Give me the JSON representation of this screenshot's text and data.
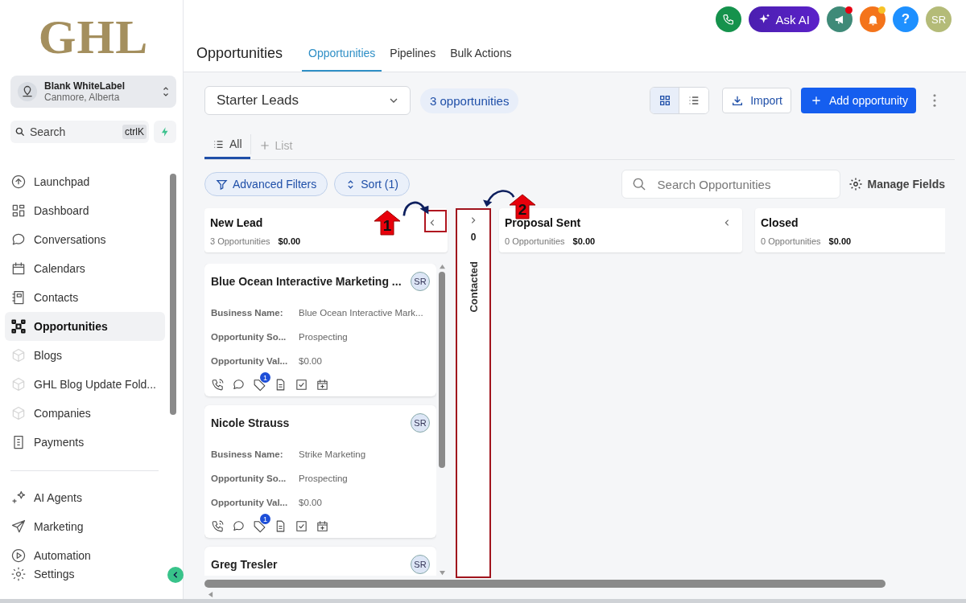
{
  "sidebar": {
    "logo": "GHL",
    "account": {
      "name": "Blank WhiteLabel",
      "location": "Canmore, Alberta"
    },
    "search": {
      "placeholder": "Search",
      "shortcut": "ctrlK"
    },
    "items": [
      {
        "label": "Launchpad",
        "selected": false
      },
      {
        "label": "Dashboard",
        "selected": false
      },
      {
        "label": "Conversations",
        "selected": false
      },
      {
        "label": "Calendars",
        "selected": false
      },
      {
        "label": "Contacts",
        "selected": false
      },
      {
        "label": "Opportunities",
        "selected": true
      },
      {
        "label": "Blogs",
        "selected": false
      },
      {
        "label": "GHL Blog Update Fold...",
        "selected": false
      },
      {
        "label": "Companies",
        "selected": false
      },
      {
        "label": "Payments",
        "selected": false
      }
    ],
    "bottom_items": [
      {
        "label": "AI Agents",
        "selected": false
      },
      {
        "label": "Marketing",
        "selected": false
      },
      {
        "label": "Automation",
        "selected": false
      },
      {
        "label": "Settings",
        "selected": false
      }
    ]
  },
  "topbar": {
    "ask_ai": "Ask AI",
    "help": "?",
    "avatar": "SR"
  },
  "header": {
    "title": "Opportunities",
    "tabs": [
      {
        "label": "Opportunities",
        "selected": true
      },
      {
        "label": "Pipelines",
        "selected": false
      },
      {
        "label": "Bulk Actions",
        "selected": false
      }
    ]
  },
  "toolbar": {
    "pipeline": "Starter Leads",
    "count": "3 opportunities",
    "view_modes": [
      {
        "kind": "grid",
        "selected": true
      },
      {
        "kind": "list",
        "selected": false
      }
    ],
    "import": "Import",
    "add": "Add opportunity"
  },
  "view_tabs": [
    {
      "label": "All",
      "selected": true
    }
  ],
  "add_list": "List",
  "filters": {
    "advanced": "Advanced Filters",
    "sort": "Sort (1)",
    "search_placeholder": "Search Opportunities",
    "manage_fields": "Manage Fields"
  },
  "columns": [
    {
      "name": "New Lead",
      "count": "3 Opportunities",
      "value": "$0.00",
      "collapsed": false,
      "callout": "1",
      "cards": [
        {
          "title": "Blue Ocean Interactive Marketing ...",
          "avatar": "SR",
          "fields": [
            {
              "label": "Business Name:",
              "value": "Blue Ocean Interactive Mark..."
            },
            {
              "label": "Opportunity So...",
              "value": "Prospecting"
            },
            {
              "label": "Opportunity Val...",
              "value": "$0.00"
            }
          ],
          "badge": "1"
        },
        {
          "title": "Nicole Strauss",
          "avatar": "SR",
          "fields": [
            {
              "label": "Business Name:",
              "value": "Strike Marketing"
            },
            {
              "label": "Opportunity So...",
              "value": "Prospecting"
            },
            {
              "label": "Opportunity Val...",
              "value": "$0.00"
            }
          ],
          "badge": "1"
        },
        {
          "title": "Greg Tresler",
          "avatar": "SR"
        }
      ]
    },
    {
      "name": "Contacted",
      "count": "0",
      "collapsed": true,
      "callout": "2"
    },
    {
      "name": "Proposal Sent",
      "count": "0 Opportunities",
      "value": "$0.00",
      "collapsed": false
    },
    {
      "name": "Closed",
      "count": "0 Opportunities",
      "value": "$0.00",
      "collapsed": false
    }
  ]
}
